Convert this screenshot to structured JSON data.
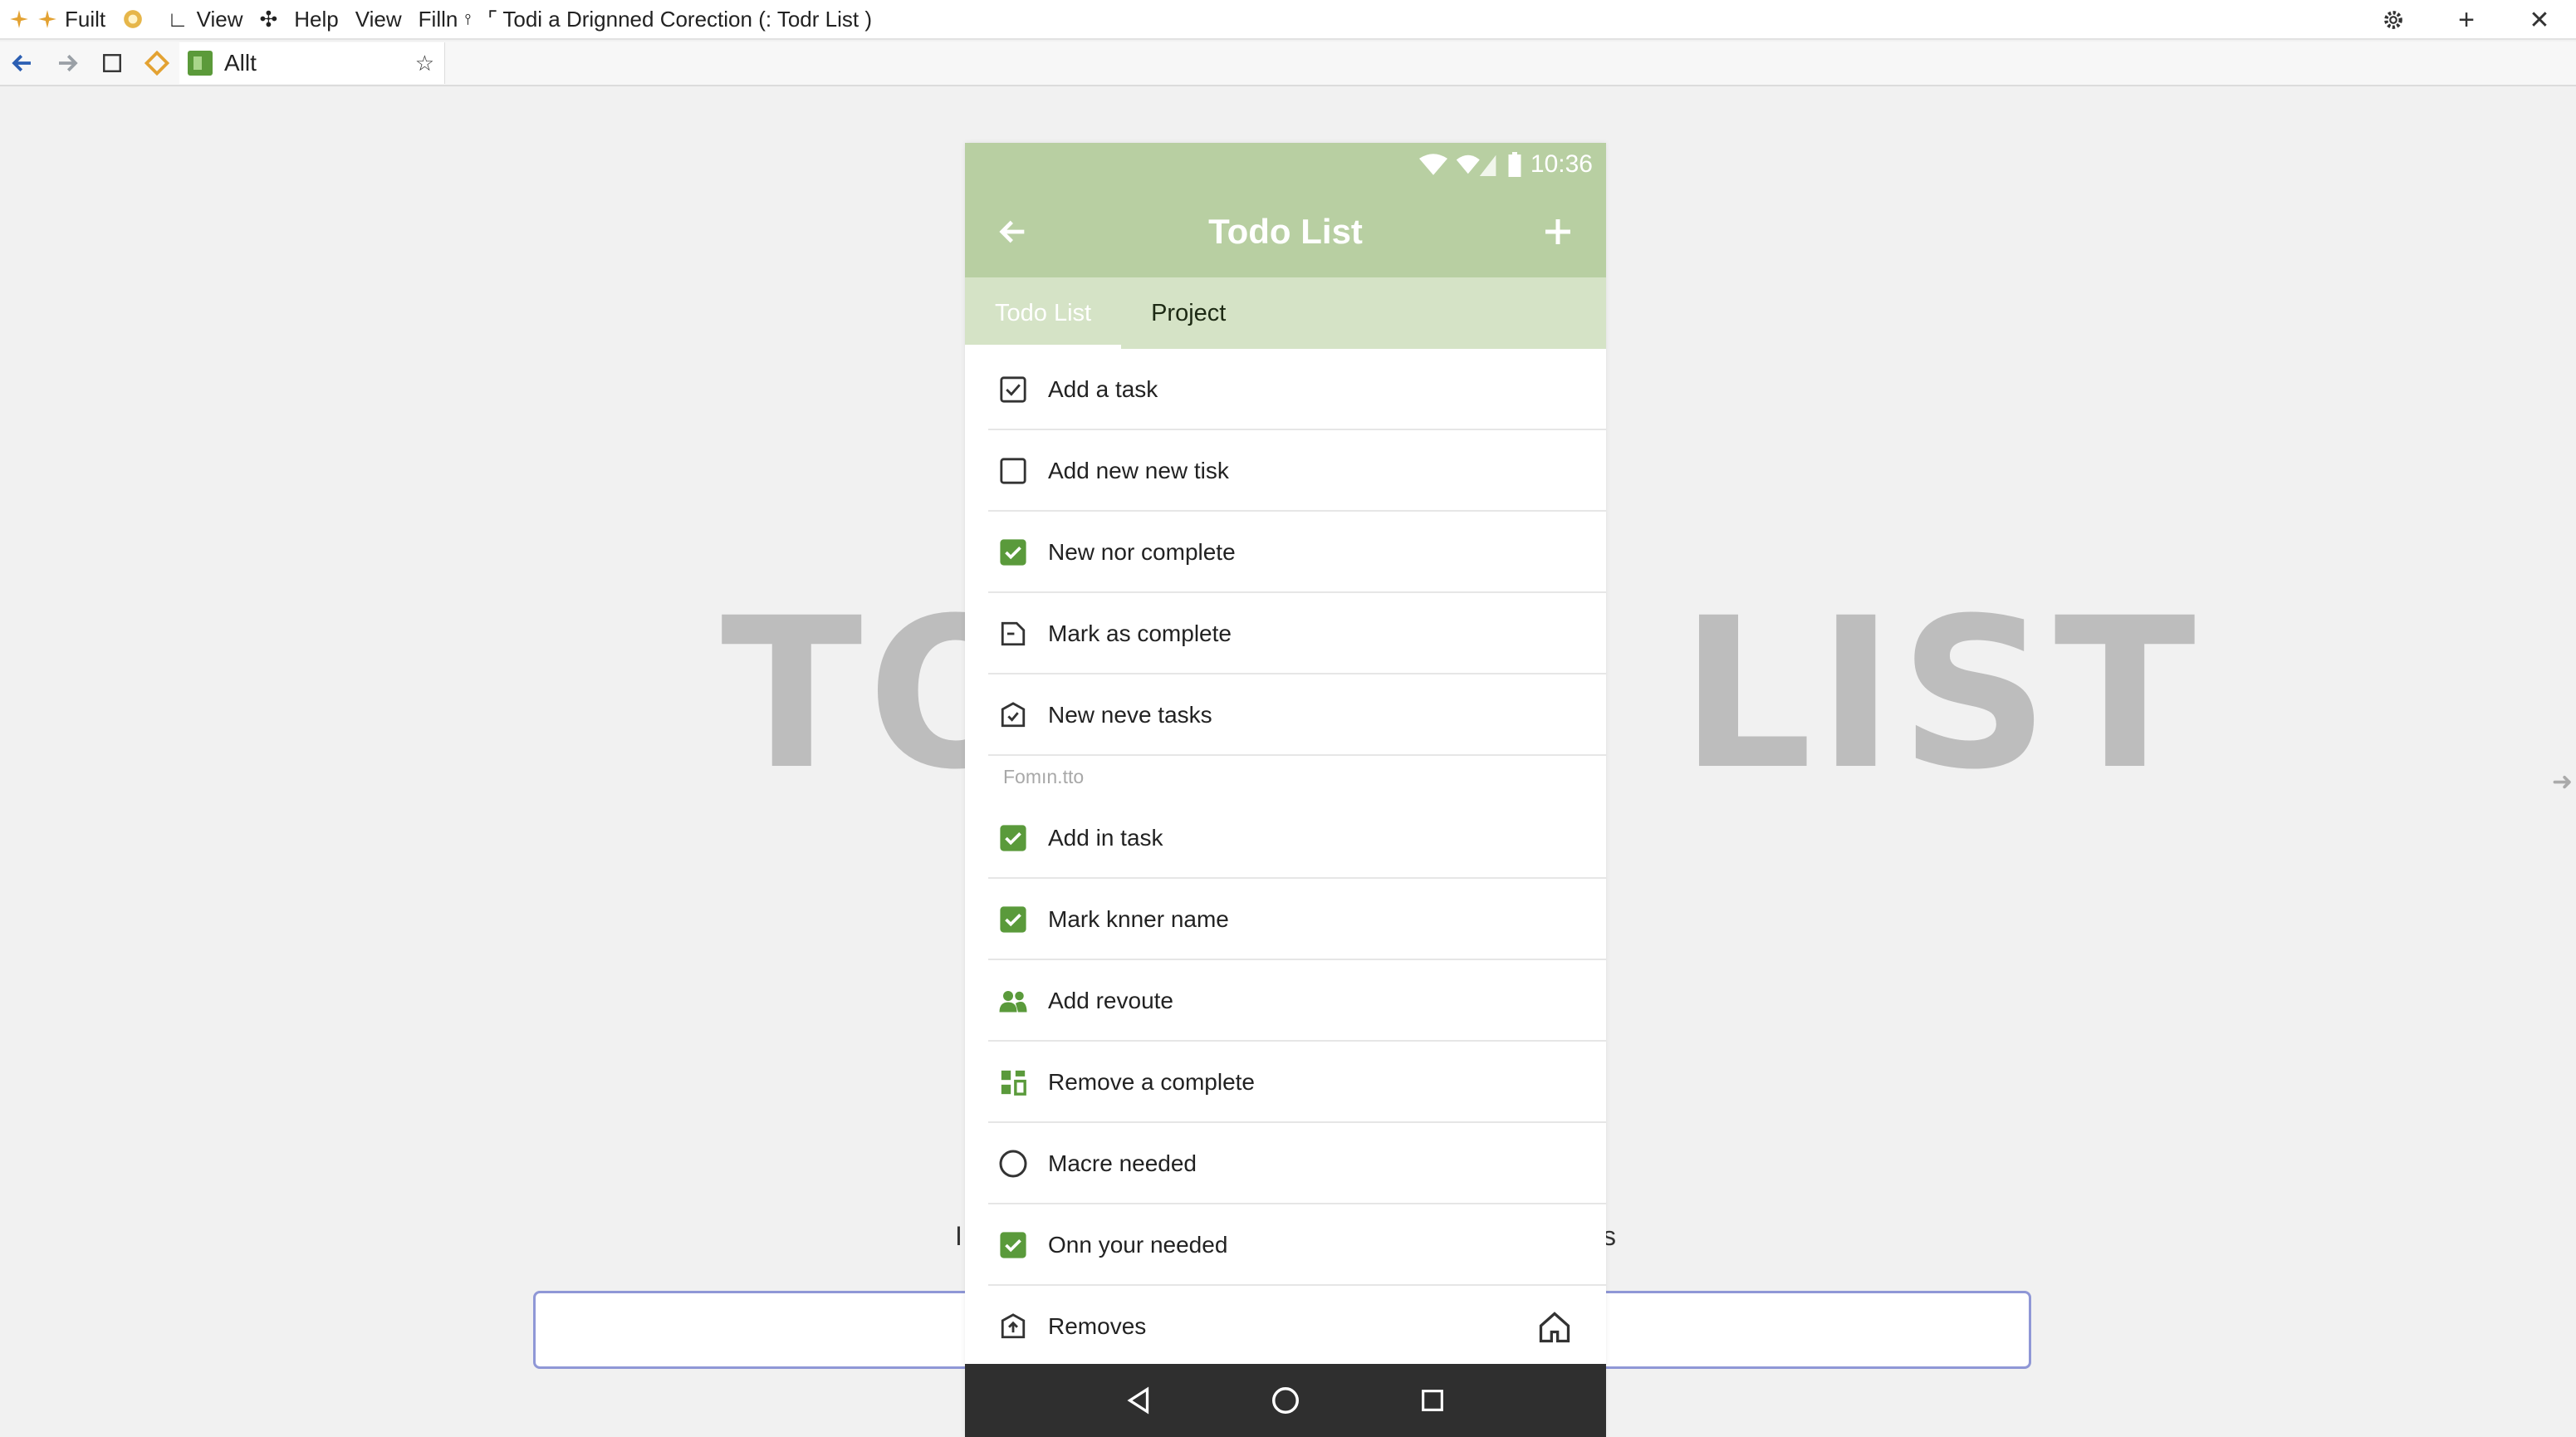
{
  "menubar": {
    "items": [
      "Fuilt",
      "View",
      "Help",
      "View",
      "Filln",
      "Todi a Drignned Corection (: Todr List )"
    ],
    "settings_icon": "gear-icon",
    "new_tab_icon": "plus-icon",
    "close_icon": "close-icon"
  },
  "toolbar": {
    "tab_label": "Allt"
  },
  "background": {
    "title_left": "TO",
    "title_right": "LIST",
    "frag_left": "I",
    "frag_right": "s"
  },
  "phone": {
    "status": {
      "time": "10:36"
    },
    "appbar": {
      "title": "Todo List"
    },
    "tabs": [
      "Todo List",
      "Project"
    ],
    "active_tab": 0,
    "list_group_1": [
      {
        "label": "Add a task",
        "icon": "checkbox-outline-checked-icon"
      },
      {
        "label": "Add new new tisk",
        "icon": "checkbox-empty-icon"
      },
      {
        "label": "New nor complete",
        "icon": "checkbox-checked-green-icon"
      },
      {
        "label": "Mark as complete",
        "icon": "document-icon"
      },
      {
        "label": "New neve tasks",
        "icon": "tag-check-icon"
      }
    ],
    "section_label": "Fomın.tto",
    "list_group_2": [
      {
        "label": "Add in task",
        "icon": "checkbox-checked-green-icon"
      },
      {
        "label": "Mark knner name",
        "icon": "checkbox-checked-green-icon"
      },
      {
        "label": "Add revoute",
        "icon": "people-icon"
      },
      {
        "label": "Remove a complete",
        "icon": "dashboard-icon"
      },
      {
        "label": "Macre needed",
        "icon": "radio-empty-icon"
      },
      {
        "label": "Onn your needed",
        "icon": "checkbox-checked-green-icon"
      },
      {
        "label": "Removes",
        "icon": "upload-box-icon"
      }
    ]
  },
  "colors": {
    "appbar": "#b8cfa2",
    "tabs_bg": "#d5e3c6",
    "accent_green": "#5a9a3b",
    "navbar": "#2f2f2f",
    "input_border": "#8f97d6"
  }
}
